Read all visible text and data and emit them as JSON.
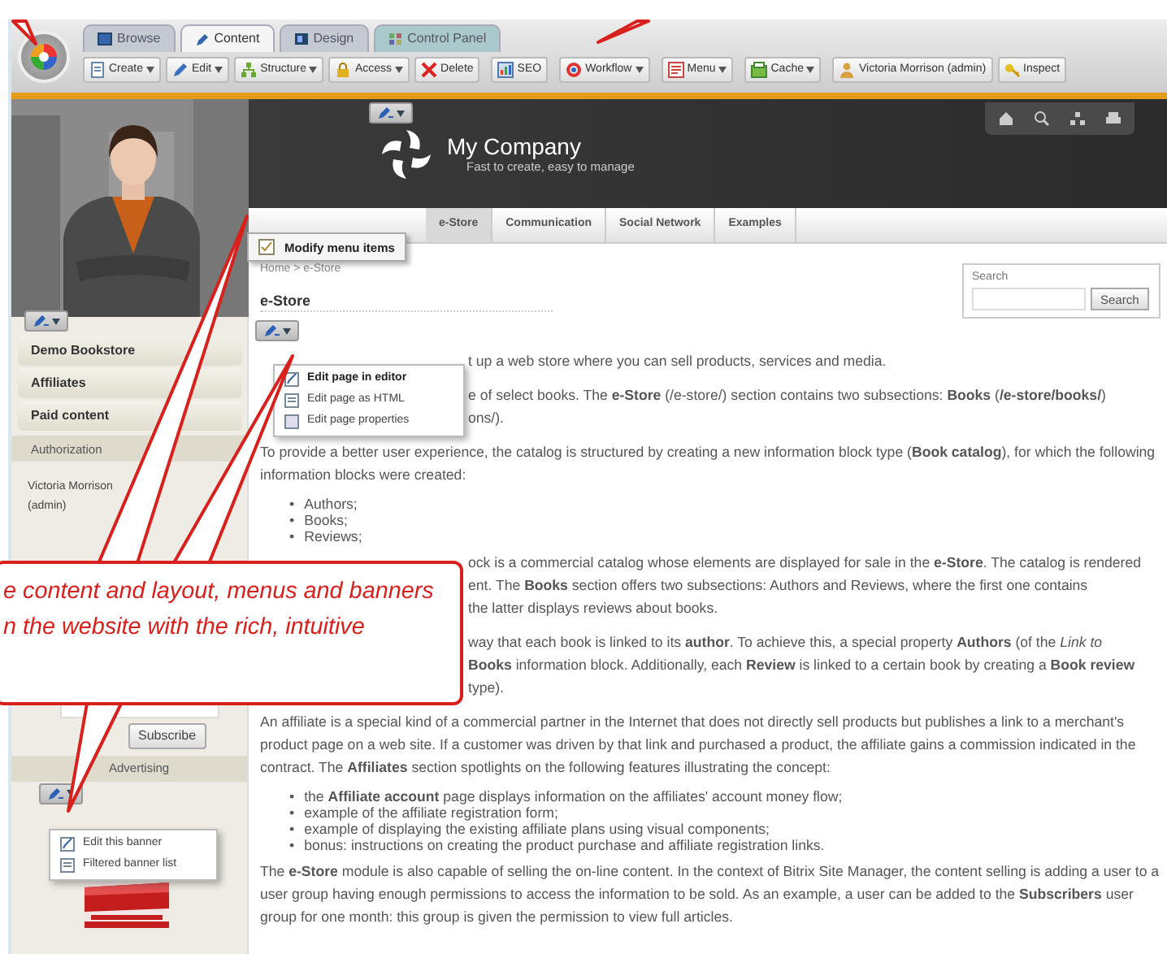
{
  "admin_panel": {
    "tabs": [
      {
        "label": "Browse",
        "selected": false
      },
      {
        "label": "Content",
        "selected": true
      },
      {
        "label": "Design",
        "selected": false
      },
      {
        "label": "Control Panel",
        "selected": false
      }
    ],
    "toolbar": [
      {
        "label": "Create",
        "has_menu": true
      },
      {
        "label": "Edit",
        "has_menu": true
      },
      {
        "label": "Structure",
        "has_menu": true
      },
      {
        "label": "Access",
        "has_menu": true
      },
      {
        "label": "Delete",
        "has_menu": false
      },
      {
        "label": "SEO",
        "has_menu": false
      },
      {
        "label": "Workflow",
        "has_menu": true
      },
      {
        "label": "Menu",
        "has_menu": true
      },
      {
        "label": "Cache",
        "has_menu": true
      },
      {
        "label": "Victoria Morrison (admin)",
        "has_menu": false
      },
      {
        "label": "Inspect",
        "has_menu": false
      }
    ]
  },
  "header": {
    "site_name": "My Company",
    "slogan": "Fast to create, easy to manage"
  },
  "menu_popup": {
    "label": "Modify menu items"
  },
  "nav": [
    {
      "label": "e-Store",
      "selected": true
    },
    {
      "label": "Communication",
      "selected": false
    },
    {
      "label": "Social Network",
      "selected": false
    },
    {
      "label": "Examples",
      "selected": false
    }
  ],
  "sidebar": {
    "items": [
      {
        "label": "Demo Bookstore"
      },
      {
        "label": "Affiliates"
      },
      {
        "label": "Paid content"
      }
    ],
    "auth_title": "Authorization",
    "user": [
      "Victoria Morrison",
      "(admin)"
    ],
    "subscribe": "Subscribe",
    "ad_title": "Advertising",
    "banner_menu": [
      {
        "label": "Edit this banner"
      },
      {
        "label": "Filtered banner list"
      }
    ],
    "banner": {
      "kind": "picture"
    }
  },
  "content": {
    "breadcrumb": "Home > e-Store",
    "title": "e-Store",
    "search": {
      "label": "Search",
      "button": "Search"
    },
    "edit_menu": [
      {
        "label": "Edit page in editor",
        "selected": true
      },
      {
        "label": "Edit page as HTML",
        "selected": false
      },
      {
        "label": "Edit page properties",
        "selected": false
      }
    ],
    "blocks": [
      {
        "kind": "clipped",
        "lines": [
          "t up a web store where you can sell products, services and media."
        ]
      },
      {
        "kind": "clipped",
        "lines": [
          "e of select books. The **e-Store** (/e-store/) section contains two subsections: **Books** (**/e-store/books/**)",
          "ons/)."
        ]
      },
      {
        "kind": "para",
        "text": "To provide a better user experience, the catalog is structured by creating a new information block type (**Book catalog**), for which the following information blocks were created:"
      },
      {
        "kind": "list",
        "marker": "•",
        "items": [
          "Authors;",
          "Books;",
          "Reviews;"
        ]
      },
      {
        "kind": "clipped",
        "lines": [
          "ock is a commercial catalog whose elements are displayed for sale in the **e-Store**. The catalog is rendered",
          "ent. The **Books** section offers two subsections: Authors and Reviews, where the first one contains",
          "the latter displays reviews about books."
        ]
      },
      {
        "kind": "clipped",
        "lines": [
          "way that each book is linked to its **author**. To achieve this, a special property **Authors** (of the *Link to*",
          "**Books** information block. Additionally, each **Review** is linked to a certain book by creating a **Book review**",
          "type)."
        ]
      },
      {
        "kind": "para",
        "text": "An affiliate is a special kind of a commercial partner in the Internet that does not directly sell products but publishes a link to a merchant's product page on a web site. If a customer was driven by that link and purchased a product, the affiliate gains a commission indicated in the contract. The **Affiliates** section spotlights on the following features illustrating the concept:"
      },
      {
        "kind": "list",
        "marker": "•",
        "items": [
          "the **Affiliate account** page displays information on the affiliates' account money flow;",
          "example of the affiliate registration form;",
          "example of displaying the existing affiliate plans using visual components;",
          "bonus: instructions on creating the product purchase and affiliate registration links."
        ]
      },
      {
        "kind": "para",
        "text": "The **e-Store** module is also capable of selling the on-line content. In the context of Bitrix Site Manager, the content selling is adding a user to a user group having enough permissions to access the information to be sold. As an example, a user can be added to the **Subscribers** user group for one month: this group is given the permission to view full articles."
      }
    ]
  },
  "callout": {
    "lines": [
      "e content and layout, menus and banners",
      "n the website with the rich, intuitive"
    ]
  }
}
